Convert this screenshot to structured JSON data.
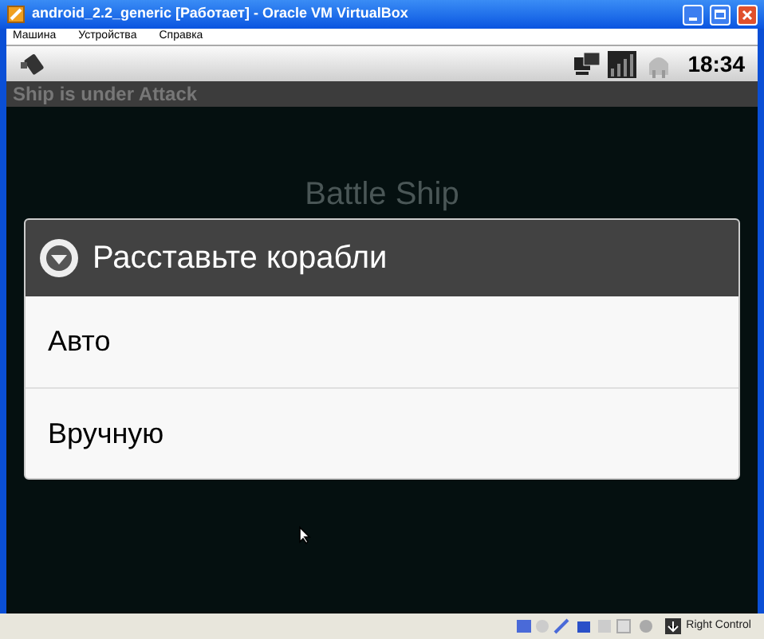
{
  "window": {
    "title": "android_2.2_generic [Работает] - Oracle VM VirtualBox"
  },
  "menu": [
    "Машина",
    "Устройства",
    "Справка"
  ],
  "android_status": {
    "time": "18:34"
  },
  "app": {
    "title": "Ship is under Attack",
    "heading": "Battle Ship"
  },
  "dialog": {
    "title": "Расставьте корабли",
    "items": [
      "Авто",
      "Вручную"
    ]
  },
  "status_bar": {
    "host_key": "Right Control"
  }
}
